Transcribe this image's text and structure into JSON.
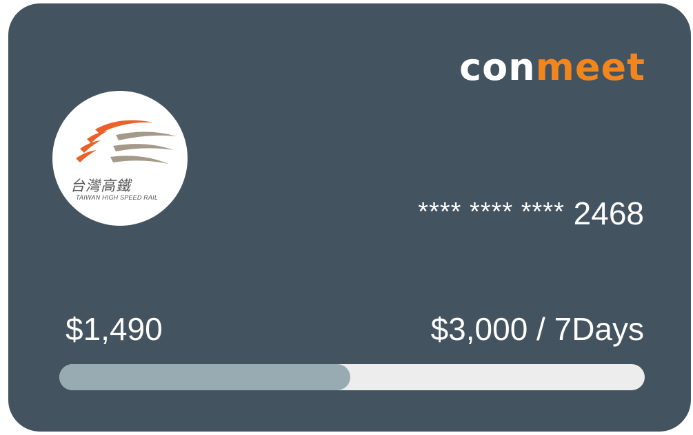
{
  "card": {
    "brand_prefix": "con",
    "brand_suffix": "meet",
    "issuer_name_zh": "台灣高鐵",
    "issuer_name_en": "TAIWAN HIGH SPEED RAIL",
    "card_number_mask": "**** **** ****",
    "card_number_last4": "2468",
    "spent_amount": "$1,490",
    "limit_text": "$3,000 / 7Days",
    "progress_fraction": 0.4967,
    "colors": {
      "card_background": "#43535f",
      "brand_accent": "#f2861d",
      "progress_fill": "#98abb3",
      "progress_track": "#ededed"
    }
  }
}
